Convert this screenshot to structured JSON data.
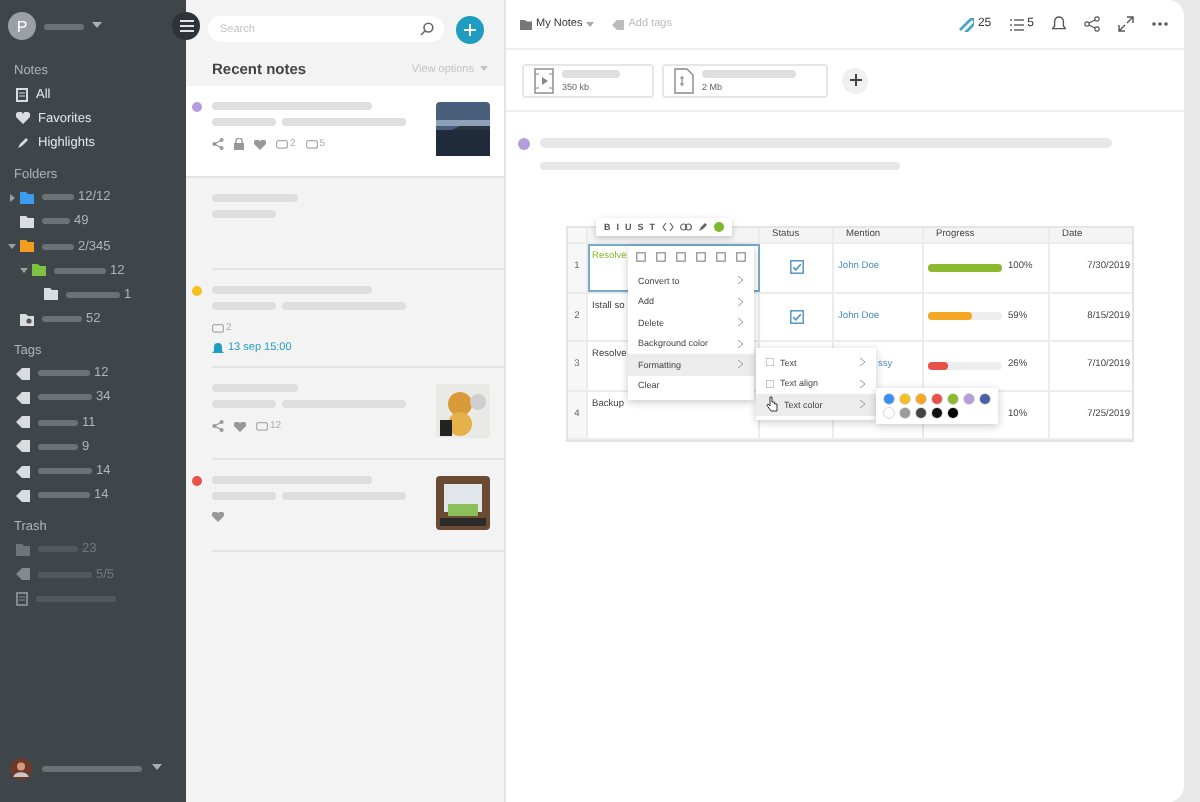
{
  "sidebar": {
    "avatar_letter": "P",
    "sections": [
      {
        "kind": "notes",
        "title": "Notes",
        "items": [
          {
            "kind": "note",
            "label": "All"
          },
          {
            "kind": "heart",
            "label": "Favorites"
          },
          {
            "kind": "marker",
            "label": "Highlights"
          }
        ]
      },
      {
        "kind": "folders",
        "title": "Folders",
        "items": [
          {
            "kind": "folder",
            "color": "#3b9df0",
            "count": "12/12",
            "expanded": false
          },
          {
            "kind": "folder",
            "color": "#d9dddf",
            "count": "49"
          },
          {
            "kind": "folder",
            "color": "#f39c1f",
            "count": "2/345",
            "expanded": true,
            "children": [
              {
                "kind": "folder",
                "color": "#7dc242",
                "count": "12",
                "expanded": true,
                "children": [
                  {
                    "kind": "folder",
                    "color": "#d9dddf",
                    "count": "1"
                  }
                ]
              }
            ]
          },
          {
            "kind": "shared",
            "color": "#d9dddf",
            "count": "52"
          }
        ]
      },
      {
        "kind": "tags",
        "title": "Tags",
        "items": [
          {
            "kind": "tag",
            "count": "12"
          },
          {
            "kind": "tag",
            "count": "34"
          },
          {
            "kind": "tag",
            "count": "11"
          },
          {
            "kind": "tag",
            "count": "9"
          },
          {
            "kind": "tag",
            "count": "14"
          },
          {
            "kind": "tag",
            "count": "14"
          }
        ]
      },
      {
        "kind": "trash",
        "title": "Trash",
        "items": [
          {
            "kind": "folder",
            "count": "23"
          },
          {
            "kind": "tag",
            "count": "5/5"
          },
          {
            "kind": "note"
          }
        ]
      }
    ]
  },
  "notes_list": {
    "search": {
      "placeholder": "Search"
    },
    "title": "Recent notes",
    "view_options": "View options",
    "notes": [
      {
        "selected": true,
        "color": "#b39ddb",
        "thumbnail": {
          "kind": "picture"
        },
        "meta": [
          {
            "kind": "share"
          },
          {
            "kind": "lock"
          },
          {
            "kind": "heart"
          },
          {
            "kind": "comments",
            "text": "2"
          },
          {
            "kind": "views",
            "text": "5"
          }
        ]
      },
      {
        "selected": false
      },
      {
        "selected": false,
        "color": "#f5c01d",
        "meta": [
          {
            "kind": "comments",
            "text": "2"
          }
        ],
        "reminder": "13 sep 15:00"
      },
      {
        "selected": false,
        "thumbnail": {
          "kind": "picture"
        },
        "meta": [
          {
            "kind": "share"
          },
          {
            "kind": "heart"
          },
          {
            "kind": "views",
            "text": "12"
          }
        ]
      },
      {
        "selected": false,
        "color": "#e8504a",
        "thumbnail": {
          "kind": "picture"
        },
        "meta": [
          {
            "kind": "heart"
          }
        ]
      }
    ]
  },
  "editor": {
    "folder": "My Notes",
    "add_tags": "Add tags",
    "stats": [
      {
        "kind": "attachments",
        "text": "25"
      },
      {
        "kind": "checklist",
        "text": "5"
      }
    ],
    "attachments": [
      {
        "kind": "video",
        "size": "350 kb"
      },
      {
        "kind": "document",
        "size": "2 Mb"
      }
    ],
    "table": {
      "columns": [
        {
          "label": "Status"
        },
        {
          "label": "Mention"
        },
        {
          "label": "Progress"
        },
        {
          "label": "Date"
        }
      ],
      "rows": [
        {
          "number": "1",
          "text": "Resolve",
          "selected": true,
          "status": {
            "checked": true
          },
          "mention": "John Doe",
          "progress": {
            "level": 1,
            "color": "#8cba2d",
            "reading": "100%"
          },
          "date": "7/30/2019"
        },
        {
          "number": "2",
          "text": "Istall so",
          "selected": false,
          "status": {
            "checked": true
          },
          "mention": "John Doe",
          "progress": {
            "level": 0.59,
            "color": "#f5a623",
            "reading": "59%"
          },
          "date": "8/15/2019"
        },
        {
          "number": "3",
          "text": "Resolve",
          "selected": false,
          "mention_tail": "ssy",
          "progress": {
            "level": 0.26,
            "color": "#e8504a",
            "reading": "26%"
          },
          "date": "7/10/2019"
        },
        {
          "number": "4",
          "text": "Backup",
          "selected": false,
          "progress": {
            "reading": "10%"
          },
          "date": "7/25/2019"
        }
      ]
    },
    "format_toolbar": [
      {
        "text": "B"
      },
      {
        "text": "I"
      },
      {
        "text": "U"
      },
      {
        "text": "S"
      },
      {
        "text": "T"
      },
      {
        "kind": "code"
      },
      {
        "kind": "link"
      },
      {
        "kind": "marker"
      },
      {
        "color": "#7cb82f"
      }
    ],
    "context_menu": {
      "items": [
        {
          "label": "Convert to",
          "submenu": true,
          "selected": false
        },
        {
          "label": "Add",
          "submenu": true,
          "selected": false
        },
        {
          "label": "Delete",
          "submenu": true,
          "selected": false
        },
        {
          "label": "Background color",
          "submenu": true,
          "selected": false
        },
        {
          "label": "Formatting",
          "submenu": true,
          "selected": true
        },
        {
          "label": "Clear",
          "submenu": false,
          "selected": false
        }
      ]
    },
    "submenu": {
      "items": [
        {
          "label": "Text",
          "selected": false
        },
        {
          "label": "Text align",
          "selected": false
        },
        {
          "label": "Text color",
          "selected": true
        }
      ]
    },
    "palette": [
      [
        {
          "color": "#3b8ff0"
        },
        {
          "color": "#f5c01d"
        },
        {
          "color": "#f5a623"
        },
        {
          "color": "#e8504a"
        },
        {
          "color": "#8cba2d"
        },
        {
          "color": "#b39ddb"
        },
        {
          "color": "#4a5fa8"
        }
      ],
      [
        {
          "color": "#ffffff"
        },
        {
          "color": "#9a9a9a"
        },
        {
          "color": "#444444"
        },
        {
          "color": "#111111"
        },
        {
          "color": "#000000"
        }
      ]
    ]
  }
}
